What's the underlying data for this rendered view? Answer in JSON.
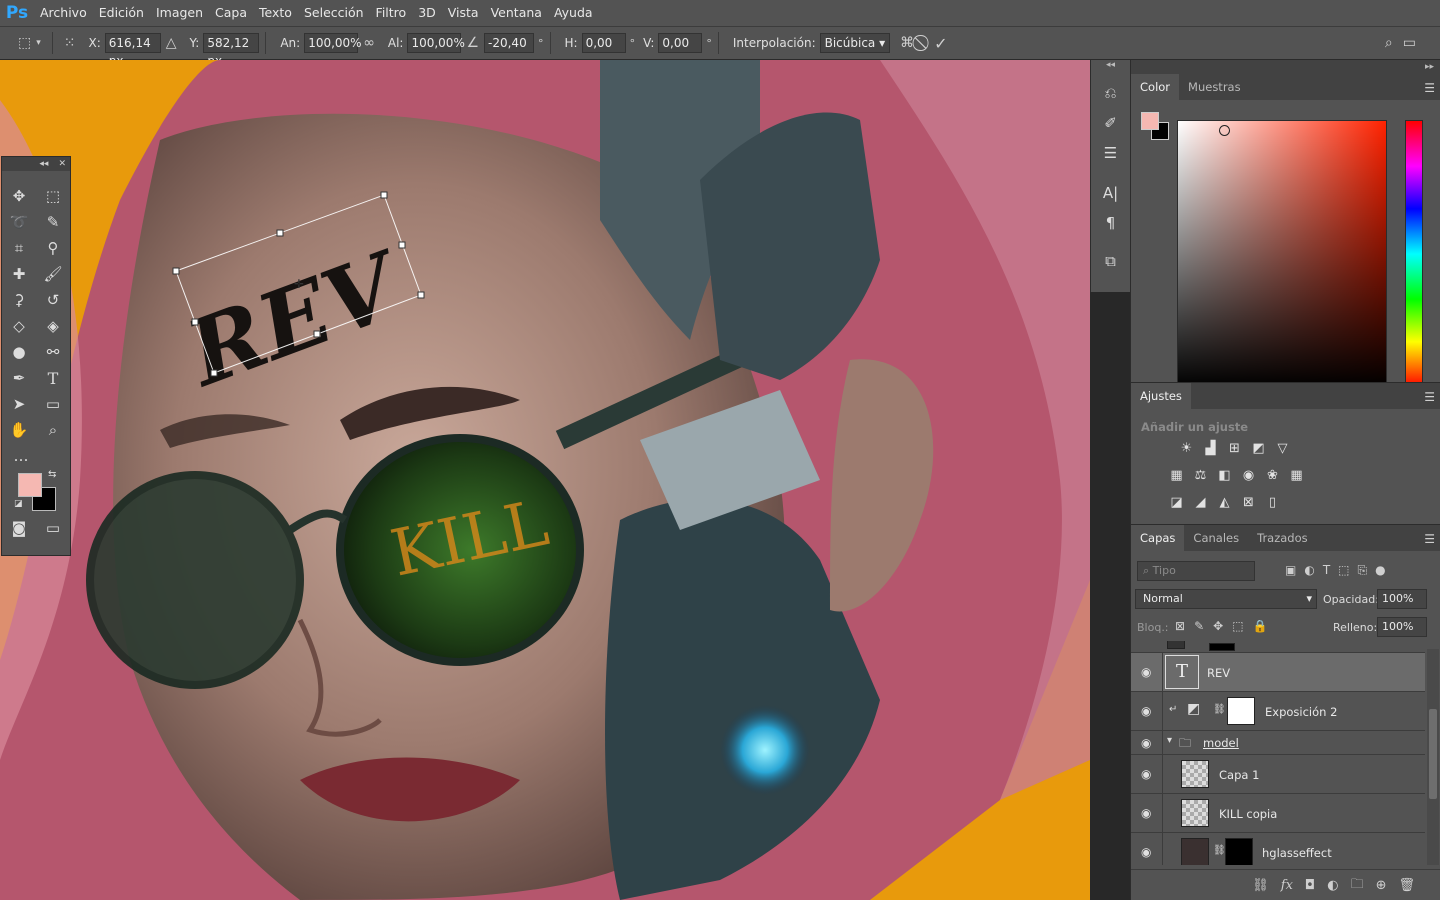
{
  "app": {
    "logo": "Ps"
  },
  "menu": [
    "Archivo",
    "Edición",
    "Imagen",
    "Capa",
    "Texto",
    "Selección",
    "Filtro",
    "3D",
    "Vista",
    "Ventana",
    "Ayuda"
  ],
  "options": {
    "x_label": "X:",
    "x_value": "616,14 px",
    "y_label": "Y:",
    "y_value": "582,12 px",
    "w_label": "An:",
    "w_value": "100,00%",
    "h_label": "Al:",
    "h_value": "100,00%",
    "angle_value": "-20,40",
    "angle_unit": "°",
    "hskew_label": "H:",
    "hskew_value": "0,00",
    "vskew_label": "V:",
    "vskew_value": "0,00",
    "interp_label": "Interpolación:",
    "interp_value": "Bicúbica"
  },
  "canvas": {
    "rev_text": "REV",
    "kill_text": "KILL",
    "background_color": "#e89a0c"
  },
  "toolbox": {
    "foreground_color": "#f5b8b2",
    "background_color": "#000000"
  },
  "color_panel": {
    "tabs": [
      "Color",
      "Muestras"
    ],
    "active_tab": 0
  },
  "adjustments_panel": {
    "title": "Ajustes",
    "subtitle": "Añadir un ajuste"
  },
  "layers_panel": {
    "tabs": [
      "Capas",
      "Canales",
      "Trazados"
    ],
    "filter_placeholder": "Tipo",
    "blend_mode": "Normal",
    "opacity_label": "Opacidad:",
    "opacity_value": "100%",
    "lock_label": "Bloq.:",
    "fill_label": "Relleno:",
    "fill_value": "100%",
    "layers": [
      {
        "name": "REV",
        "type": "text",
        "selected": true
      },
      {
        "name": "Exposición 2",
        "type": "adjustment"
      },
      {
        "name": "model",
        "type": "group"
      },
      {
        "name": "Capa 1",
        "type": "pixel"
      },
      {
        "name": "KILL copia",
        "type": "pixel"
      },
      {
        "name": "hglasseffect",
        "type": "masked"
      }
    ]
  }
}
